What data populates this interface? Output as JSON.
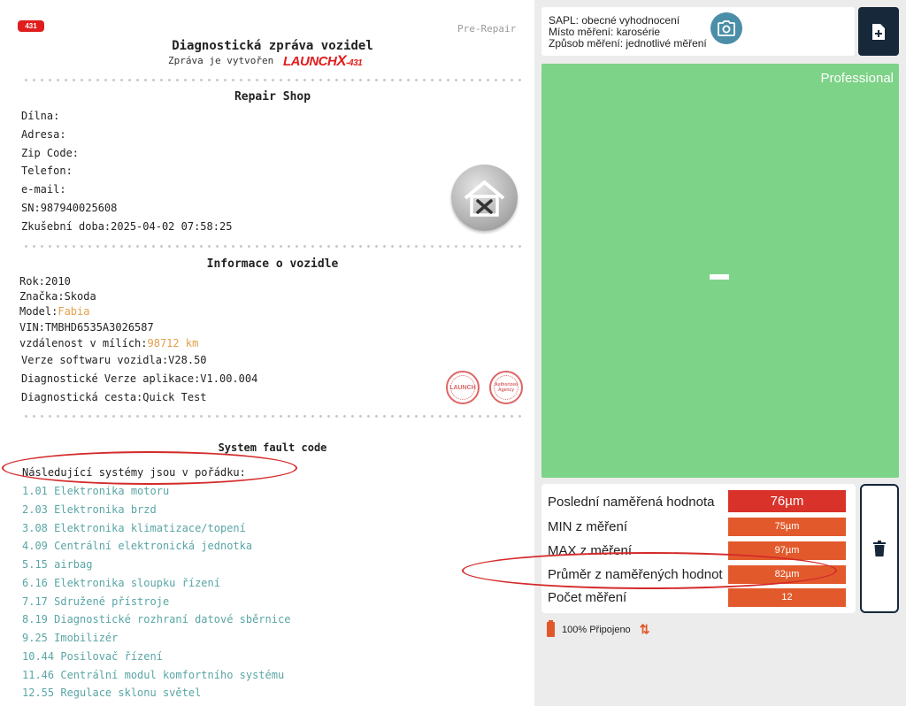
{
  "report": {
    "badge": "431",
    "pre_repair": "Pre-Repair",
    "title": "Diagnostická zpráva vozidel",
    "subtitle": "Zpráva je vytvořen",
    "logo_text": "LAUNCH",
    "logo_x": "X",
    "logo_num": "-431",
    "repair_shop": {
      "heading": "Repair Shop",
      "rows": [
        {
          "label": "Dílna:",
          "value": ""
        },
        {
          "label": "Adresa:",
          "value": ""
        },
        {
          "label": "Zip Code:",
          "value": ""
        },
        {
          "label": "Telefon:",
          "value": ""
        },
        {
          "label": "e-mail:",
          "value": ""
        },
        {
          "label": "SN:",
          "value": "987940025608"
        },
        {
          "label": "Zkušební doba:",
          "value": "2025-04-02 07:58:25"
        }
      ]
    },
    "vehicle": {
      "heading": "Informace o vozidle",
      "rows": [
        {
          "label": "Rok:",
          "value": "2010"
        },
        {
          "label": "Značka:",
          "value": "Skoda"
        },
        {
          "label": "Model:",
          "value": "Fabia"
        },
        {
          "label": "VIN:",
          "value": "TMBHD6535A3026587"
        },
        {
          "label": "vzdálenost v mílích:",
          "value": "98712 km"
        },
        {
          "label": "Verze softwaru vozidla:",
          "value": "V28.50"
        },
        {
          "label": "Diagnostické Verze aplikace:",
          "value": "V1.00.004"
        },
        {
          "label": "Diagnostická cesta:",
          "value": "Quick Test"
        }
      ]
    },
    "stamps": [
      "LAUNCH",
      "Authorized Agency"
    ],
    "faults": {
      "heading": "System fault code",
      "ok_text": "Následující systémy jsou v pořádku:",
      "systems": [
        "1.01 Elektronika motoru",
        "2.03 Elektronika brzd",
        "3.08 Elektronika klimatizace/topení",
        "4.09 Centrální elektronická jednotka",
        "5.15 airbag",
        "6.16 Elektronika sloupku řízení",
        "7.17 Sdružené přístroje",
        "8.19 Diagnostické rozhraní datové sběrnice",
        "9.25 Imobilizér",
        "10.44 Posilovač řízení",
        "11.46 Centrální modul komfortního systému",
        "12.55 Regulace sklonu světel"
      ]
    }
  },
  "app": {
    "info": {
      "line1": "SAPL: obecné vyhodnocení",
      "line2": "Místo měření: karosérie",
      "line3": "Způsob měření: jednotlivé měření"
    },
    "display": {
      "mode": "Professional",
      "value": "-"
    },
    "measurements": [
      {
        "label": "Poslední naměřená hodnota",
        "value": "76µm"
      },
      {
        "label": "MIN z měření",
        "value": "75µm"
      },
      {
        "label": "MAX z měření",
        "value": "97µm"
      },
      {
        "label": "Průměr z naměřených hodnot",
        "value": "82µm"
      },
      {
        "label": "Počet měření",
        "value": "12"
      }
    ],
    "status": {
      "battery": "100%",
      "connection": "Připojeno"
    },
    "colors": {
      "green_display": "#7dd387",
      "value_red": "#d9322a",
      "value_orange": "#e25a2c",
      "dark_button": "#16283a",
      "camera_blue": "#4a8ea8"
    }
  }
}
